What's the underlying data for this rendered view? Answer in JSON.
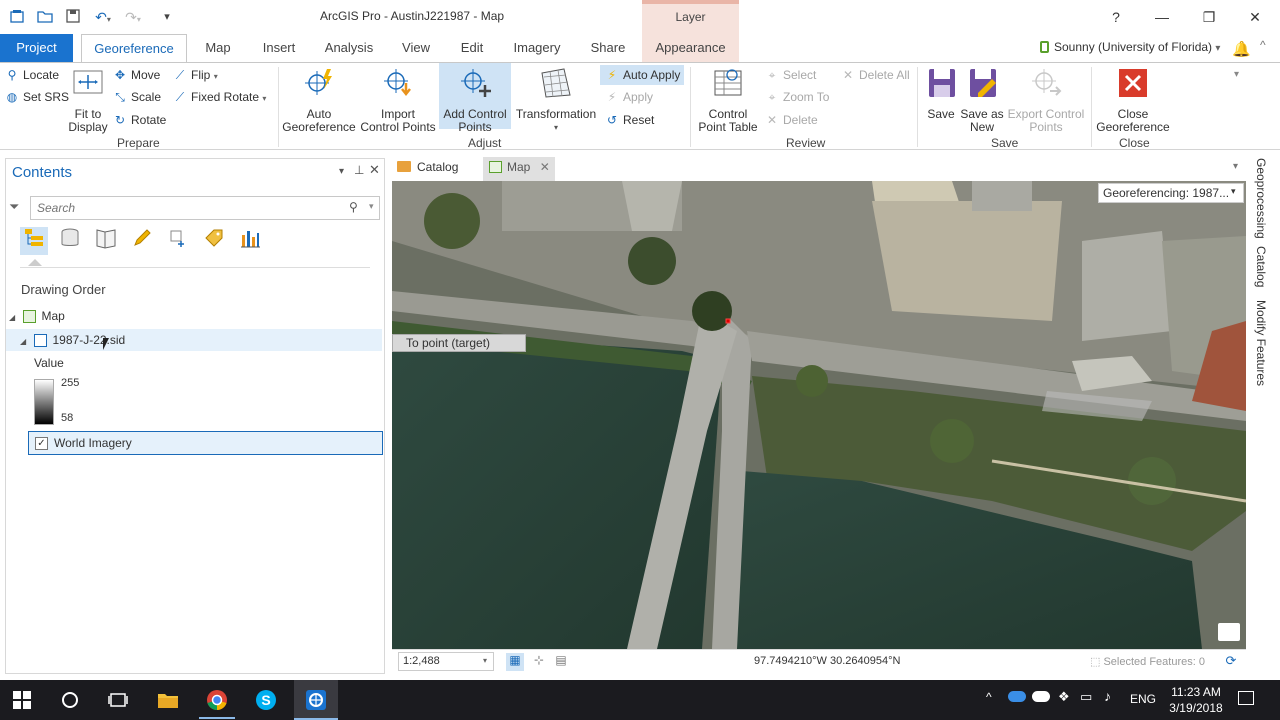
{
  "window": {
    "title": "ArcGIS Pro - AustinJ221987 - Map",
    "context_tab_group": "Layer",
    "help": "?",
    "minimize": "—",
    "restore": "❐",
    "close": "✕"
  },
  "tabs": [
    "Project",
    "Georeference",
    "Map",
    "Insert",
    "Analysis",
    "View",
    "Edit",
    "Imagery",
    "Share",
    "Appearance"
  ],
  "user": {
    "name": "Sounny (University of Florida)",
    "chevron": "▾"
  },
  "ribbon": {
    "prepare": {
      "locate": "Locate",
      "set_srs": "Set SRS",
      "fit_to_display_1": "Fit to",
      "fit_to_display_2": "Display",
      "move": "Move",
      "scale": "Scale",
      "rotate": "Rotate",
      "flip": "Flip",
      "fixed_rotate": "Fixed Rotate",
      "group": "Prepare"
    },
    "adjust": {
      "auto_georeference_1": "Auto",
      "auto_georeference_2": "Georeference",
      "import_cp_1": "Import",
      "import_cp_2": "Control Points",
      "add_cp_1": "Add Control",
      "add_cp_2": "Points",
      "transformation": "Transformation",
      "auto_apply": "Auto Apply",
      "apply": "Apply",
      "reset": "Reset",
      "group": "Adjust"
    },
    "review": {
      "cp_table_1": "Control",
      "cp_table_2": "Point Table",
      "select": "Select",
      "zoom_to": "Zoom To",
      "delete": "Delete",
      "delete_all": "Delete All",
      "group": "Review"
    },
    "save": {
      "save": "Save",
      "save_as_1": "Save as",
      "save_as_2": "New",
      "export_1": "Export Control",
      "export_2": "Points",
      "group": "Save"
    },
    "close": {
      "close_1": "Close",
      "close_2": "Georeference",
      "group": "Close"
    }
  },
  "contents": {
    "title": "Contents",
    "search_placeholder": "Search",
    "drawing_order": "Drawing Order",
    "map_node": "Map",
    "layer_name": "1987-J-22.sid",
    "value_label": "Value",
    "value_high": "255",
    "value_low": "58",
    "basemap": "World Imagery"
  },
  "map_view": {
    "tab_catalog": "Catalog",
    "tab_map": "Map",
    "tooltip": "To point (target)",
    "georef_dropdown": "Georeferencing: 1987...",
    "scale": "1:2,488",
    "coordinates": "97.7494210°W 30.2640954°N",
    "selected_features": "Selected Features: 0"
  },
  "right_rail": [
    "Geoprocessing",
    "Catalog",
    "Modify Features"
  ],
  "taskbar": {
    "language": "ENG",
    "time": "11:23 AM",
    "date": "3/19/2018"
  },
  "colors": {
    "accent": "#1a6ab8",
    "project_tab": "#1a73cf",
    "context_tab": "#f6e2dc",
    "close_red": "#d93b2b",
    "taskbar": "#1b1b1f"
  }
}
